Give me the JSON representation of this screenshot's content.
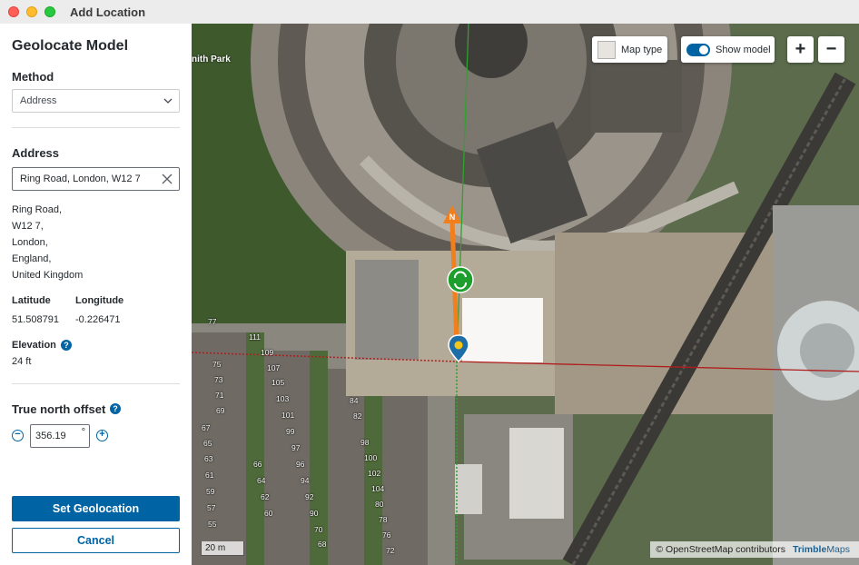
{
  "window": {
    "title": "Add Location"
  },
  "panel": {
    "title": "Geolocate Model",
    "method": {
      "label": "Method",
      "selected": "Address"
    },
    "address": {
      "label": "Address",
      "value": "Ring Road, London, W12 7",
      "result_lines": [
        "Ring Road,",
        "W12 7,",
        "London,",
        "England,",
        "United Kingdom"
      ]
    },
    "latitude": {
      "label": "Latitude",
      "value": "51.508791"
    },
    "longitude": {
      "label": "Longitude",
      "value": "-0.226471"
    },
    "elevation": {
      "label": "Elevation",
      "value": "24 ft"
    },
    "true_north": {
      "label": "True north offset",
      "value": "356.19",
      "unit": "°"
    },
    "buttons": {
      "set": "Set Geolocation",
      "cancel": "Cancel"
    }
  },
  "map": {
    "controls": {
      "map_type": "Map type",
      "show_model": "Show model",
      "show_model_on": true,
      "zoom_in": "+",
      "zoom_out": "−"
    },
    "park_label": "nith Park",
    "north_marker": "N",
    "scale": "20 m",
    "attribution": "© OpenStreetMap contributors",
    "brand": "Trimble",
    "brand_suffix": "Maps",
    "house_numbers": [
      "77",
      "111",
      "109",
      "75",
      "107",
      "73",
      "71",
      "105",
      "103",
      "69",
      "101",
      "99",
      "67",
      "97",
      "65",
      "96",
      "63",
      "94",
      "92",
      "90",
      "61",
      "59",
      "57",
      "55",
      "98",
      "100",
      "102",
      "104",
      "84",
      "82",
      "80",
      "78",
      "76",
      "72",
      "70",
      "68",
      "66",
      "64",
      "62",
      "60"
    ]
  },
  "colors": {
    "accent": "#0063a3",
    "north_arrow": "#f27f1b",
    "rotate_handle": "#1e9e2d",
    "y_axis": "#2fa12e",
    "x_axis": "#b11d1d"
  }
}
